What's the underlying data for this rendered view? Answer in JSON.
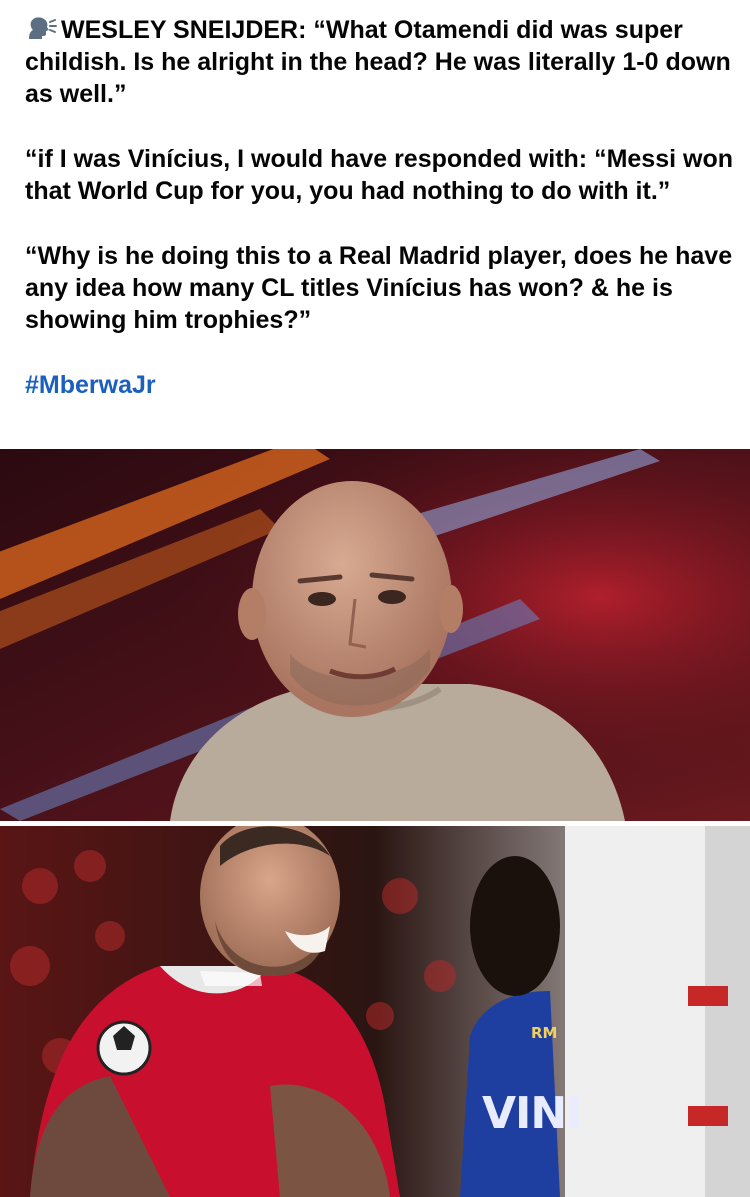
{
  "post": {
    "paragraph_1_speaker": "WESLEY SNEIJDER:",
    "paragraph_1_rest": " “What Otamendi did was super childish. Is he alright in the head? He was literally 1-0 down as well.”",
    "paragraph_2": "“if I was Vinícius, I would have responded with: “Messi won that World Cup for you, you had nothing to do with it.”",
    "paragraph_3": "“Why is he doing this to a Real Madrid player, does he have any idea how many CL titles Vinícius has won? & he is showing him trophies?”",
    "hashtag": "#MberwaJr",
    "icon": "speaking-head-icon"
  },
  "photos": {
    "photo_1": {
      "subject": "sneijder-studio-photo"
    },
    "photo_2": {
      "subject": "otamendi-vinicius-pitch-photo",
      "jersey_text": "VINI",
      "crest_text": "RM"
    }
  },
  "colors": {
    "text": "#050505",
    "hashtag": "#1b5fbf",
    "background": "#ffffff",
    "benfica_red": "#c8102e",
    "madrid_blue": "#1f3fa0"
  }
}
